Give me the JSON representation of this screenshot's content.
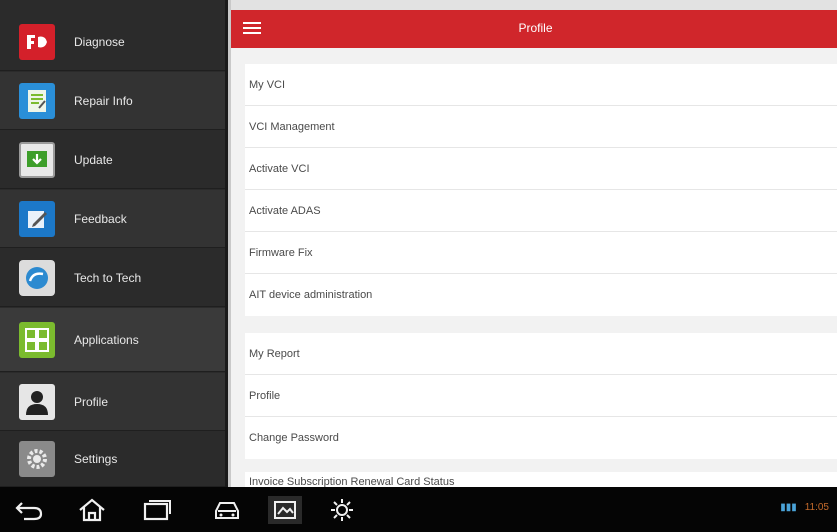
{
  "sidebar": {
    "items": [
      {
        "label": "Diagnose",
        "icon": "diagnose-icon"
      },
      {
        "label": "Repair Info",
        "icon": "repair-info-icon"
      },
      {
        "label": "Update",
        "icon": "update-icon"
      },
      {
        "label": "Feedback",
        "icon": "feedback-icon"
      },
      {
        "label": "Tech to Tech",
        "icon": "tech-to-tech-icon"
      },
      {
        "label": "Applications",
        "icon": "applications-icon"
      },
      {
        "label": "Profile",
        "icon": "profile-icon"
      },
      {
        "label": "Settings",
        "icon": "settings-icon"
      }
    ]
  },
  "header": {
    "title": "Profile",
    "menu_icon": "hamburger-menu-icon"
  },
  "groups": [
    [
      "My VCI",
      "VCI Management",
      "Activate VCI",
      "Activate ADAS",
      "Firmware Fix",
      "AIT device administration"
    ],
    [
      "My Report",
      "Profile",
      "Change Password"
    ],
    [
      "Invoice Subscription Renewal Card Status"
    ]
  ],
  "navbar": {
    "buttons": [
      "back-icon",
      "home-icon",
      "recent-apps-icon",
      "vehicle-icon",
      "screenshot-icon",
      "brightness-icon"
    ]
  },
  "status": {
    "time": "11:05"
  },
  "colors": {
    "accent": "#d0262b",
    "sidebar_bg": "#2b2b2b",
    "navbar_bg": "#050505"
  }
}
